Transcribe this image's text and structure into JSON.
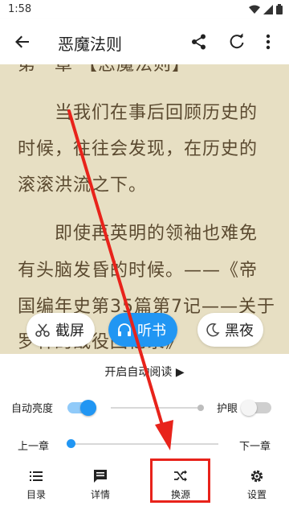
{
  "status_bar": {
    "time": "1:58"
  },
  "app_bar": {
    "title": "恶魔法则"
  },
  "reader": {
    "lines": [
      "第一章 【恶魔法则】",
      "　　当我们在事后回顾历史的",
      "时候，往往会发现，在历史的",
      "滚滚洪流之下。",
      "　　即使再英明的领袖也难免",
      "有头脑发昏的时候。——《帝",
      "国编年史第35篇第7记——关于",
      "罗林的战役回忆录》"
    ]
  },
  "pills": {
    "screenshot": "截屏",
    "listen": "听书",
    "night": "黑夜"
  },
  "panel": {
    "auto_read": "开启自动阅读 ▶",
    "auto_brightness": "自动亮度",
    "eye_care": "护眼",
    "prev_chapter": "上一章",
    "next_chapter": "下一章",
    "auto_brightness_on": true,
    "eye_care_on": false,
    "chapter_progress": 0.0
  },
  "bottom_nav": {
    "catalog": "目录",
    "details": "详情",
    "change_source": "换源",
    "settings": "设置"
  },
  "colors": {
    "accent": "#2196f3",
    "reader_bg": "#e7dfc3",
    "reader_text": "#5b4a30",
    "highlight": "#e8231b"
  }
}
